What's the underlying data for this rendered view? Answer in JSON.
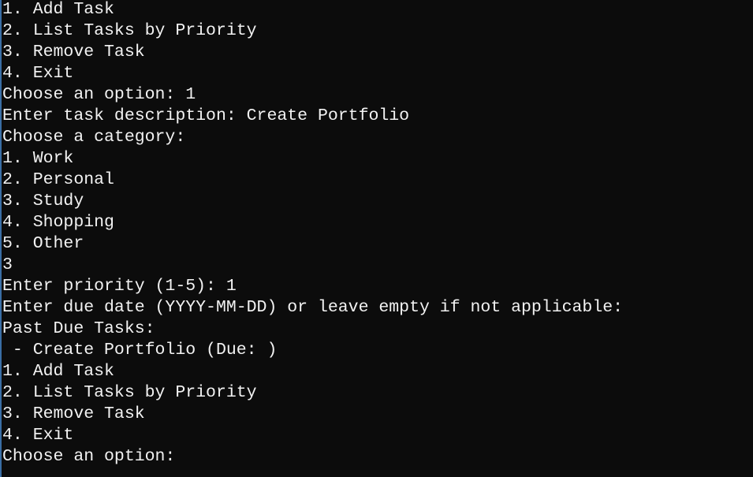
{
  "console": {
    "lines": [
      "1. Add Task",
      "2. List Tasks by Priority",
      "3. Remove Task",
      "4. Exit",
      "Choose an option: 1",
      "Enter task description: Create Portfolio",
      "Choose a category:",
      "1. Work",
      "2. Personal",
      "3. Study",
      "4. Shopping",
      "5. Other",
      "3",
      "Enter priority (1-5): 1",
      "Enter due date (YYYY-MM-DD) or leave empty if not applicable:",
      "Past Due Tasks:",
      " - Create Portfolio (Due: )",
      "1. Add Task",
      "2. List Tasks by Priority",
      "3. Remove Task",
      "4. Exit",
      "Choose an option:"
    ]
  },
  "colors": {
    "background": "#0c0c0c",
    "text": "#f2f2f2",
    "window_edge": "#3a6ea5"
  }
}
